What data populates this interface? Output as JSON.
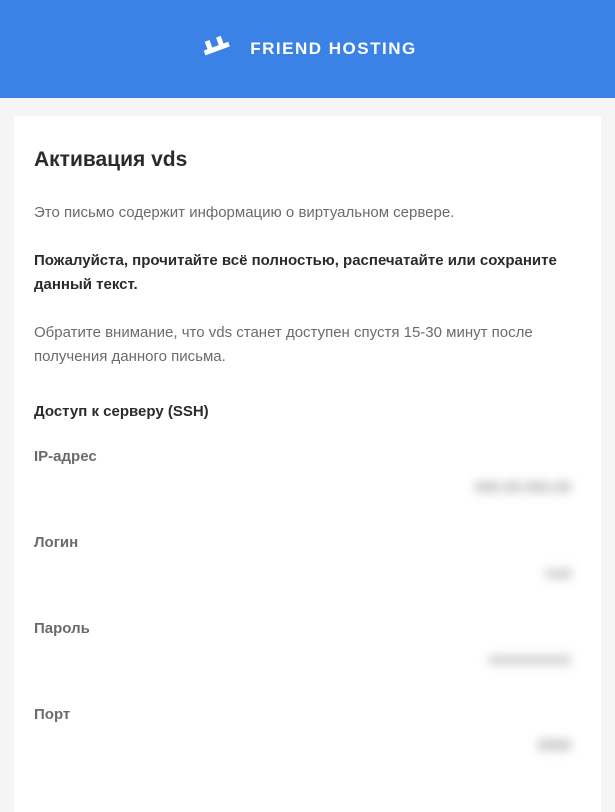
{
  "header": {
    "brand": "FRIEND HOSTING"
  },
  "content": {
    "title": "Активация vds",
    "intro": "Это письмо содержит информацию о виртуальном сервере.",
    "instruction": "Пожалуйста, прочитайте всё полностью, распечатайте или сохраните данный текст.",
    "notice": "Обратите внимание, что vds станет доступен спустя 15-30 минут после получения данного письма.",
    "ssh_section": "Доступ к серверу (SSH)",
    "fields": {
      "ip_label": "IP-адрес",
      "ip_value": "000.00.000.00",
      "login_label": "Логин",
      "login_value": "root",
      "password_label": "Пароль",
      "password_value": "xxxxxxxxxxx",
      "port_label": "Порт",
      "port_value": "0000"
    }
  }
}
